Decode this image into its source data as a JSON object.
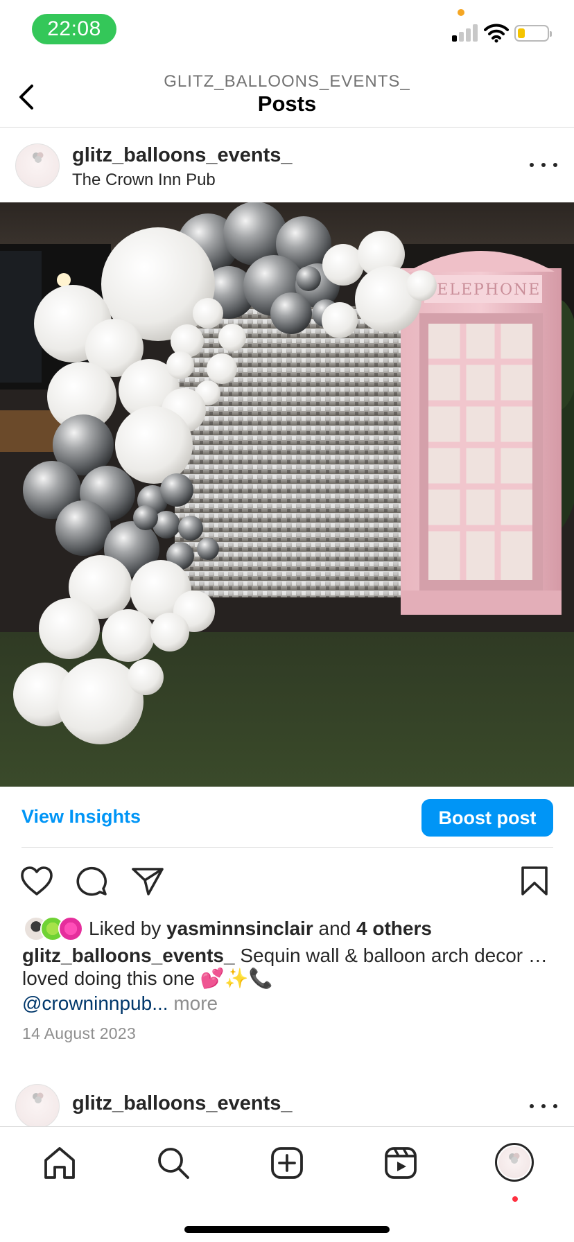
{
  "status_bar": {
    "time": "22:08",
    "icons": [
      "cellular-signal-icon",
      "wifi-icon",
      "battery-icon"
    ],
    "battery_level": 0.25,
    "colors": {
      "time_pill": "#34c759",
      "battery": "#f5c400",
      "privacy_dot": "#f5a623"
    }
  },
  "header": {
    "account": "GLITZ_BALLOONS_EVENTS_",
    "title": "Posts",
    "back_icon": "chevron-left-icon"
  },
  "post": {
    "username": "glitz_balloons_events_",
    "location": "The Crown Inn Pub",
    "more_icon": "more-horizontal-icon",
    "image_alt": "White and silver chrome balloon arch beside a silver sequin wall and a pink telephone box",
    "insights_label": "View Insights",
    "boost_label": "Boost post",
    "actions": [
      "heart-icon",
      "comment-icon",
      "share-icon",
      "bookmark-icon"
    ],
    "likes": {
      "prefix": "Liked by",
      "user": "yasminnsinclair",
      "joiner": "and",
      "others": "4 others"
    },
    "caption": {
      "username": "glitz_balloons_events_",
      "text": "Sequin wall & balloon arch decor … loved doing this one 💕✨📞",
      "mention": "@crowninnpub",
      "ellipsis": "...",
      "more": "more"
    },
    "date": "14 August 2023"
  },
  "next_post": {
    "username": "glitz_balloons_events_"
  },
  "bottom_nav": {
    "items": [
      "home-icon",
      "search-icon",
      "create-icon",
      "reels-icon",
      "profile-avatar"
    ]
  },
  "colors": {
    "accent": "#0095f6",
    "mention": "#00376b",
    "muted": "#8e8e8e",
    "notification": "#ff3040"
  }
}
